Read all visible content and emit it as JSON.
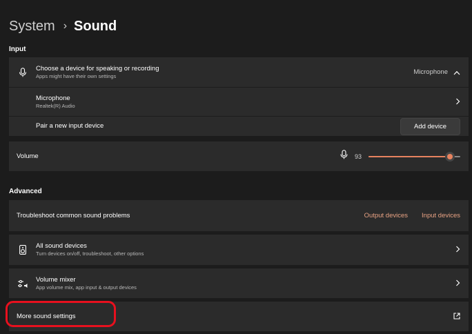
{
  "breadcrumb": {
    "parent": "System",
    "separator": "›",
    "current": "Sound"
  },
  "input_section": {
    "label": "Input",
    "choose_device": {
      "title": "Choose a device for speaking or recording",
      "subtitle": "Apps might have their own settings",
      "selected": "Microphone",
      "icon": "microphone-icon"
    },
    "microphone": {
      "title": "Microphone",
      "subtitle": "Realtek(R) Audio",
      "icon": "chevron-right-icon"
    },
    "pair": {
      "title": "Pair a new input device",
      "button": "Add device"
    },
    "volume": {
      "label": "Volume",
      "value": "93",
      "level_percent": 93,
      "icon": "microphone-icon"
    }
  },
  "advanced_section": {
    "label": "Advanced",
    "troubleshoot": {
      "title": "Troubleshoot common sound problems",
      "link_output": "Output devices",
      "link_input": "Input devices"
    },
    "all_devices": {
      "title": "All sound devices",
      "subtitle": "Turn devices on/off, troubleshoot, other options",
      "icon": "speaker-icon"
    },
    "volume_mixer": {
      "title": "Volume mixer",
      "subtitle": "App volume mix, app input & output devices",
      "icon": "mixer-icon"
    },
    "more_settings": {
      "title": "More sound settings",
      "icon": "external-link-icon"
    }
  },
  "colors": {
    "accent": "#e8835f",
    "link": "#e8a283",
    "highlight": "#e8101e",
    "card": "#2b2b2b",
    "background": "#1c1c1c"
  }
}
